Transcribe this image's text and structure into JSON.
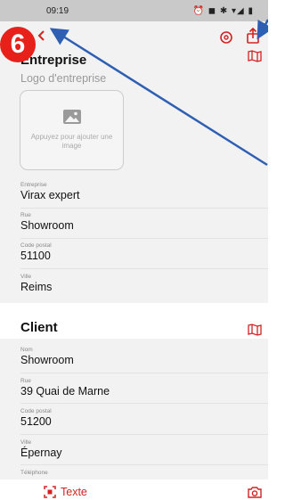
{
  "status": {
    "time": "09:19",
    "icons": "⏰ ◼ ✱ ▾◢ ▮"
  },
  "badge": {
    "number": "6"
  },
  "company": {
    "title": "Entreprise",
    "logo_label": "Logo d'entreprise",
    "logo_hint": "Appuyez pour ajouter une image",
    "fields": [
      {
        "label": "Entreprise",
        "value": "Virax expert"
      },
      {
        "label": "Rue",
        "value": "Showroom"
      },
      {
        "label": "Code postal",
        "value": "51100"
      },
      {
        "label": "Ville",
        "value": "Reims"
      }
    ]
  },
  "client": {
    "title": "Client",
    "fields": [
      {
        "label": "Nom",
        "value": "Showroom"
      },
      {
        "label": "Rue",
        "value": "39 Quai de Marne"
      },
      {
        "label": "Code postal",
        "value": "51200"
      },
      {
        "label": "Ville",
        "value": "Épernay"
      },
      {
        "label": "Téléphone",
        "value": ""
      }
    ]
  },
  "bottom": {
    "text_button": "Texte"
  },
  "colors": {
    "accent": "#d32222",
    "badge": "#e8201a",
    "arrow": "#2f5fb3",
    "section_bg": "#f2f2f2"
  },
  "icons": [
    "back-arrow-icon",
    "settings-icon",
    "share-icon",
    "map-icon",
    "image-icon",
    "text-scan-icon",
    "camera-icon"
  ]
}
